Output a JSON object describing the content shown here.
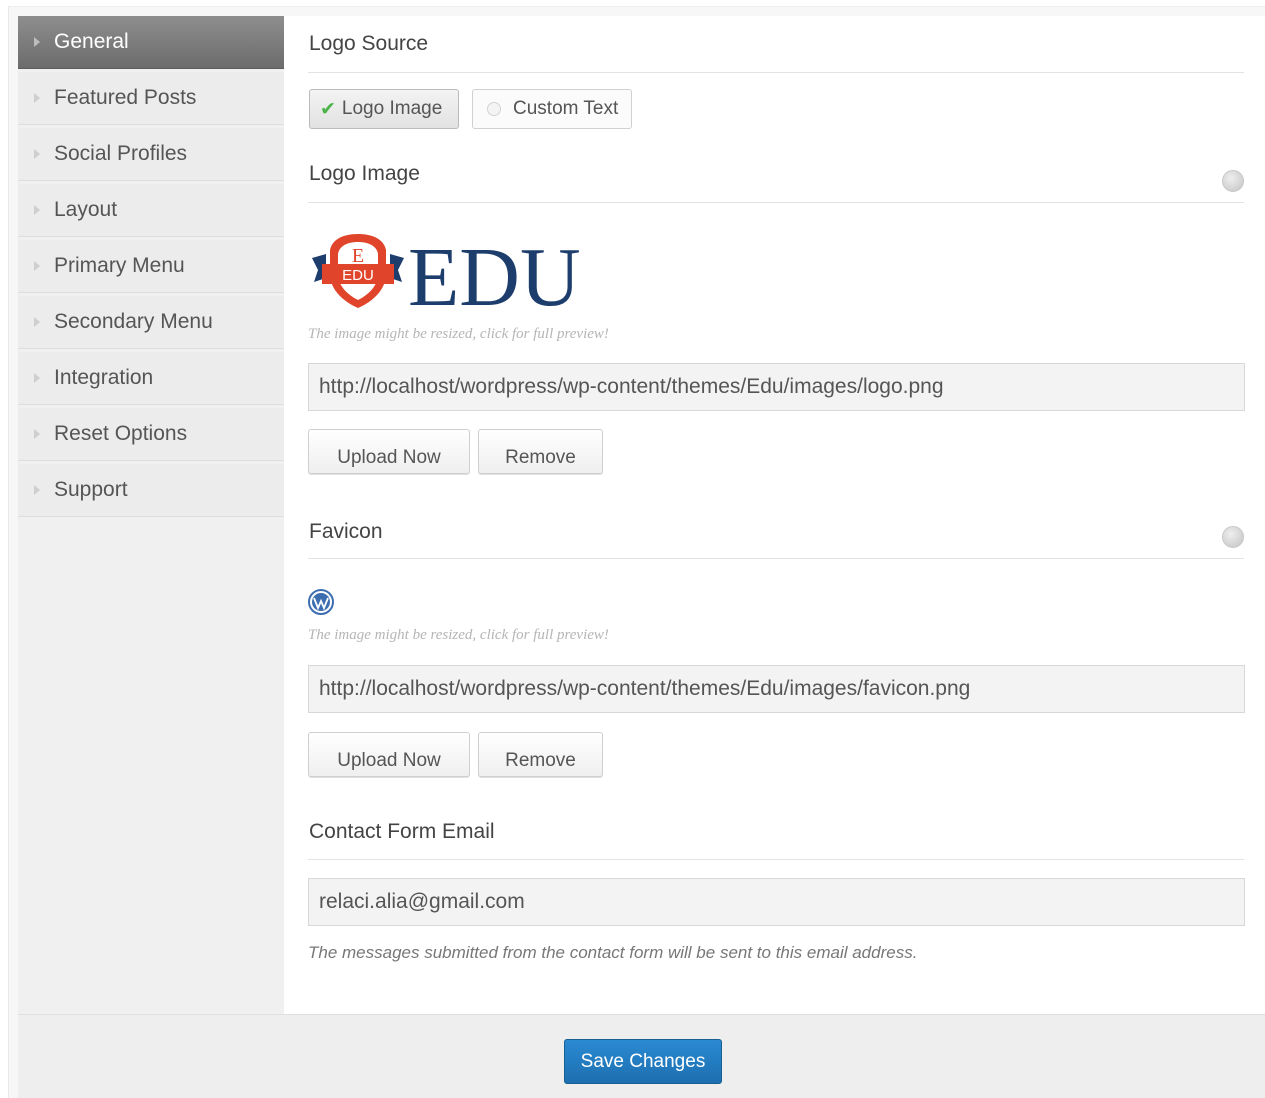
{
  "sidebar": {
    "items": [
      {
        "label": "General",
        "active": true
      },
      {
        "label": "Featured Posts"
      },
      {
        "label": "Social Profiles"
      },
      {
        "label": "Layout"
      },
      {
        "label": "Primary Menu"
      },
      {
        "label": "Secondary Menu"
      },
      {
        "label": "Integration"
      },
      {
        "label": "Reset Options"
      },
      {
        "label": "Support"
      }
    ]
  },
  "logo_source": {
    "title": "Logo Source",
    "options": [
      {
        "label": "Logo Image",
        "selected": true,
        "icon": "checkmark-icon"
      },
      {
        "label": "Custom Text",
        "selected": false,
        "icon": "radio-icon"
      }
    ]
  },
  "logo_image": {
    "title": "Logo Image",
    "preview_text": "EDU",
    "badge_letter": "E",
    "badge_text": "EDU",
    "hint": "The image might be resized, click for full preview!",
    "url": "http://localhost/wordpress/wp-content/themes/Edu/images/logo.png",
    "upload_label": "Upload Now",
    "remove_label": "Remove"
  },
  "favicon": {
    "title": "Favicon",
    "icon": "wordpress-icon",
    "hint": "The image might be resized, click for full preview!",
    "url": "http://localhost/wordpress/wp-content/themes/Edu/images/favicon.png",
    "upload_label": "Upload Now",
    "remove_label": "Remove"
  },
  "contact": {
    "title": "Contact Form Email",
    "email": "relaci.alia@gmail.com",
    "note": "The messages submitted from the contact form will be sent to this email address."
  },
  "footer": {
    "save_label": "Save Changes"
  },
  "colors": {
    "accent": "#2277bf",
    "logo_navy": "#1d3e6d",
    "logo_red": "#e0452b",
    "check_green": "#4cb34a"
  }
}
